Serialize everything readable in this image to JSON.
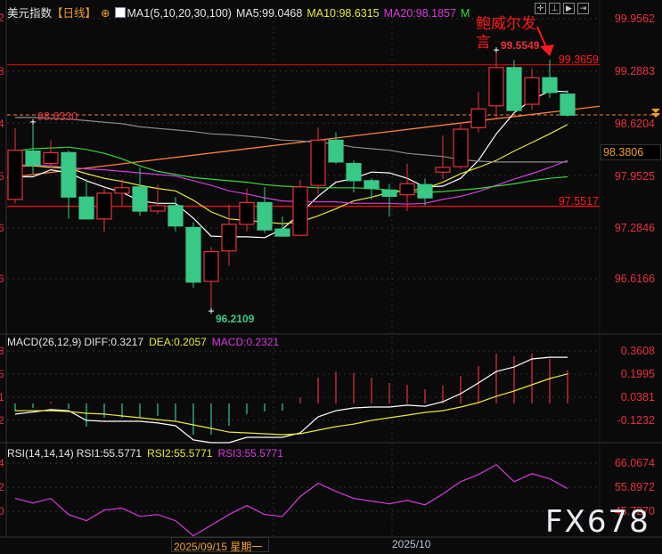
{
  "header": {
    "instrument": "美元指数",
    "period": "【日线】",
    "ma_params": "MA1(5,10,20,30,100)",
    "ma5": "MA5:99.0468",
    "ma10": "MA10:98.6315",
    "ma20": "MA20:98.1857",
    "ma30_truncated": "M"
  },
  "toolbar": {
    "icons": [
      "crosshair-icon",
      "fit-icon",
      "play-icon",
      "shift-right-icon"
    ]
  },
  "macd_header": {
    "label": "MACD(26,12,9)",
    "diff": "DIFF:0.3217",
    "dea": "DEA:0.2057",
    "macd": "MACD:0.2321"
  },
  "rsi_header": {
    "label": "RSI(14,14,14)",
    "rsi1": "RSI1:55.5771",
    "rsi2": "RSI2:55.5771",
    "rsi3": "RSI3:55.5771"
  },
  "price_axis": {
    "ticks": [
      "99.9562",
      "99.2883",
      "98.6204",
      "97.9525",
      "97.2846",
      "96.6166"
    ],
    "left_partial": [
      "2",
      "8",
      "4",
      "5",
      "6",
      "6"
    ]
  },
  "macd_axis": {
    "ticks": [
      "0.3608",
      "0.1995",
      "0.0381",
      "-0.1232"
    ],
    "left_partial": [
      "8",
      "5",
      "1",
      "2"
    ]
  },
  "rsi_axis": {
    "ticks": [
      "66.0674",
      "55.8972",
      "45.7270"
    ],
    "left_partial": [
      "4",
      "2",
      "0"
    ]
  },
  "price_levels": {
    "resistance": "99.3659",
    "support": "97.5517",
    "dashed_ref": "98.6330",
    "current_box": "98.3806",
    "high_label": "99.5549",
    "low_label": "96.2109"
  },
  "annotation": {
    "line1": "鲍威尔发",
    "line2": "言"
  },
  "time_axis": {
    "cursor_label": "2025/09/15 星期一",
    "month_label": "2025/10"
  },
  "watermark": "FX678",
  "colors": {
    "up": "#e8313d",
    "down": "#38c987",
    "ma5": "#ffffff",
    "ma10": "#e8e83a",
    "ma20": "#d63cdc",
    "ma30": "#3bd63b",
    "ma100": "#8c8c8c",
    "trend": "#ff8040",
    "axis_text": "#e8313d",
    "period": "#f0a030"
  },
  "chart_data": [
    {
      "type": "candlestick",
      "ylim": [
        96.0,
        100.0
      ],
      "candles": [
        {
          "o": 97.64,
          "h": 98.55,
          "l": 97.59,
          "c": 98.27
        },
        {
          "o": 98.26,
          "h": 98.633,
          "l": 97.97,
          "c": 98.08
        },
        {
          "o": 98.1,
          "h": 98.4,
          "l": 98.04,
          "c": 98.24
        },
        {
          "o": 98.24,
          "h": 98.27,
          "l": 97.39,
          "c": 97.67
        },
        {
          "o": 97.67,
          "h": 97.9,
          "l": 97.38,
          "c": 97.39
        },
        {
          "o": 97.39,
          "h": 97.78,
          "l": 97.22,
          "c": 97.72
        },
        {
          "o": 97.72,
          "h": 97.9,
          "l": 97.56,
          "c": 97.79
        },
        {
          "o": 97.8,
          "h": 98.05,
          "l": 97.43,
          "c": 97.49
        },
        {
          "o": 97.49,
          "h": 97.83,
          "l": 97.45,
          "c": 97.56
        },
        {
          "o": 97.56,
          "h": 97.67,
          "l": 97.23,
          "c": 97.3
        },
        {
          "o": 97.28,
          "h": 97.35,
          "l": 96.51,
          "c": 96.58
        },
        {
          "o": 96.59,
          "h": 97.03,
          "l": 96.2109,
          "c": 96.97
        },
        {
          "o": 96.98,
          "h": 97.57,
          "l": 96.79,
          "c": 97.32
        },
        {
          "o": 97.32,
          "h": 97.78,
          "l": 97.23,
          "c": 97.6
        },
        {
          "o": 97.6,
          "h": 97.8,
          "l": 97.21,
          "c": 97.25
        },
        {
          "o": 97.26,
          "h": 97.42,
          "l": 97.16,
          "c": 97.17
        },
        {
          "o": 97.18,
          "h": 97.89,
          "l": 97.17,
          "c": 97.8
        },
        {
          "o": 97.82,
          "h": 98.56,
          "l": 97.71,
          "c": 98.4
        },
        {
          "o": 98.4,
          "h": 98.5,
          "l": 98.1,
          "c": 98.12
        },
        {
          "o": 98.1,
          "h": 98.14,
          "l": 97.73,
          "c": 97.88
        },
        {
          "o": 97.88,
          "h": 97.91,
          "l": 97.64,
          "c": 97.78
        },
        {
          "o": 97.76,
          "h": 97.84,
          "l": 97.42,
          "c": 97.68
        },
        {
          "o": 97.7,
          "h": 98.1,
          "l": 97.49,
          "c": 97.84
        },
        {
          "o": 97.83,
          "h": 97.91,
          "l": 97.56,
          "c": 97.66
        },
        {
          "o": 97.99,
          "h": 98.46,
          "l": 97.9,
          "c": 98.05
        },
        {
          "o": 98.06,
          "h": 98.63,
          "l": 98.03,
          "c": 98.54
        },
        {
          "o": 98.56,
          "h": 99.02,
          "l": 98.5,
          "c": 98.8
        },
        {
          "o": 98.84,
          "h": 99.5549,
          "l": 98.66,
          "c": 99.33
        },
        {
          "o": 99.33,
          "h": 99.43,
          "l": 98.77,
          "c": 98.78
        },
        {
          "o": 98.86,
          "h": 99.32,
          "l": 98.79,
          "c": 99.2
        },
        {
          "o": 99.2,
          "h": 99.43,
          "l": 98.94,
          "c": 99.01
        },
        {
          "o": 98.99,
          "h": 99.04,
          "l": 98.7,
          "c": 98.72
        }
      ],
      "series": [
        {
          "name": "MA5",
          "color": "#ffffff",
          "values": [
            97.93,
            97.93,
            98.02,
            97.98,
            97.88,
            97.8,
            97.73,
            97.62,
            97.59,
            97.59,
            97.4,
            97.17,
            97.16,
            97.16,
            97.15,
            97.26,
            97.46,
            97.68,
            97.86,
            97.91,
            97.99,
            97.98,
            97.91,
            97.8,
            97.81,
            97.91,
            98.14,
            98.48,
            98.75,
            98.92,
            99.03,
            99.02
          ]
        },
        {
          "name": "MA10",
          "color": "#e8e83a",
          "values": [
            98.07,
            98.07,
            98.05,
            98.04,
            97.97,
            97.91,
            97.87,
            97.82,
            97.78,
            97.75,
            97.63,
            97.48,
            97.39,
            97.37,
            97.35,
            97.33,
            97.35,
            97.43,
            97.52,
            97.62,
            97.67,
            97.73,
            97.75,
            97.78,
            97.86,
            97.97,
            98.05,
            98.14,
            98.26,
            98.37,
            98.48,
            98.6
          ]
        },
        {
          "name": "MA20",
          "color": "#d63cdc",
          "values": [
            98.08,
            98.08,
            98.07,
            98.05,
            98.03,
            98.02,
            98.0,
            97.98,
            97.96,
            97.94,
            97.88,
            97.82,
            97.75,
            97.71,
            97.66,
            97.62,
            97.61,
            97.61,
            97.61,
            97.59,
            97.59,
            97.59,
            97.58,
            97.59,
            97.64,
            97.68,
            97.74,
            97.82,
            97.9,
            97.97,
            98.05,
            98.14
          ]
        },
        {
          "name": "MA30",
          "color": "#3bd63b",
          "values": [
            98.26,
            98.29,
            98.3,
            98.31,
            98.28,
            98.23,
            98.16,
            98.07,
            98.0,
            97.96,
            97.92,
            97.9,
            97.88,
            97.86,
            97.83,
            97.81,
            97.8,
            97.79,
            97.79,
            97.79,
            97.78,
            97.76,
            97.74,
            97.73,
            97.74,
            97.76,
            97.78,
            97.81,
            97.84,
            97.88,
            97.91,
            97.93
          ]
        },
        {
          "name": "MA100",
          "color": "#8c8c8c",
          "values": [
            98.69,
            98.69,
            98.68,
            98.67,
            98.65,
            98.63,
            98.61,
            98.57,
            98.55,
            98.53,
            98.51,
            98.48,
            98.47,
            98.45,
            98.43,
            98.4,
            98.39,
            98.37,
            98.35,
            98.31,
            98.29,
            98.27,
            98.23,
            98.21,
            98.19,
            98.15,
            98.13,
            98.12,
            98.12,
            98.12,
            98.12,
            98.12
          ]
        }
      ],
      "trendline": {
        "from": 97.93,
        "to": 98.8
      }
    },
    {
      "type": "macd",
      "ylim": [
        -0.3,
        0.4
      ],
      "histogram": [
        -0.056,
        -0.031,
        0.012,
        -0.037,
        -0.161,
        -0.099,
        -0.099,
        -0.099,
        -0.087,
        -0.118,
        -0.217,
        -0.217,
        -0.155,
        -0.074,
        -0.056,
        -0.05,
        0.043,
        0.18,
        0.223,
        0.211,
        0.18,
        0.143,
        0.13,
        0.099,
        0.124,
        0.192,
        0.261,
        0.347,
        0.329,
        0.347,
        0.31,
        0.2321
      ],
      "diff": [
        -0.074,
        -0.06,
        -0.043,
        -0.05,
        -0.118,
        -0.124,
        -0.124,
        -0.124,
        -0.136,
        -0.155,
        -0.254,
        -0.273,
        -0.273,
        -0.236,
        -0.236,
        -0.236,
        -0.205,
        -0.093,
        -0.05,
        -0.031,
        -0.025,
        -0.025,
        -0.012,
        -0.019,
        0.012,
        0.068,
        0.143,
        0.223,
        0.254,
        0.31,
        0.322,
        0.3217
      ],
      "dea": [
        -0.05,
        -0.05,
        -0.05,
        -0.056,
        -0.068,
        -0.074,
        -0.087,
        -0.099,
        -0.112,
        -0.124,
        -0.149,
        -0.174,
        -0.199,
        -0.205,
        -0.211,
        -0.217,
        -0.211,
        -0.186,
        -0.161,
        -0.143,
        -0.118,
        -0.099,
        -0.081,
        -0.062,
        -0.05,
        -0.025,
        0.006,
        0.05,
        0.087,
        0.13,
        0.174,
        0.2057
      ]
    },
    {
      "type": "line",
      "ylim": [
        30,
        70
      ],
      "rsi": [
        51.4,
        49.5,
        51.4,
        44.6,
        42.0,
        46.5,
        47.3,
        43.8,
        44.6,
        42.0,
        35.6,
        40.1,
        44.6,
        48.4,
        44.6,
        43.8,
        52.2,
        57.8,
        54.4,
        51.4,
        50.3,
        49.1,
        50.6,
        48.7,
        53.3,
        58.5,
        61.5,
        65.7,
        58.5,
        61.9,
        59.7,
        55.58
      ]
    }
  ]
}
